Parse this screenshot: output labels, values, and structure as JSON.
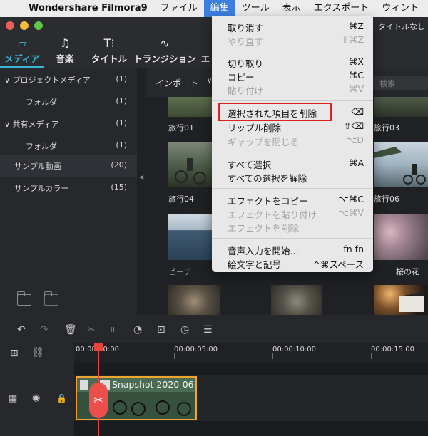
{
  "menubar": {
    "app_name": "Wondershare Filmora9",
    "items": [
      "ファイル",
      "編集",
      "ツール",
      "表示",
      "エクスポート",
      "ウィント"
    ]
  },
  "window": {
    "title_right": "タイトルなし"
  },
  "tabs": [
    {
      "label": "メディア",
      "icon": "folder-icon"
    },
    {
      "label": "音楽",
      "icon": "music-note-icon"
    },
    {
      "label": "タイトル",
      "icon": "title-text-icon"
    },
    {
      "label": "トランジション",
      "icon": "transition-icon"
    },
    {
      "label": "エ",
      "icon": "effects-icon"
    }
  ],
  "sidebar": {
    "items": [
      {
        "label": "∨ プロジェクトメディア",
        "count": "(1)"
      },
      {
        "label": "フォルダ",
        "count": "(1)"
      },
      {
        "label": "∨ 共有メディア",
        "count": "(1)"
      },
      {
        "label": "フォルダ",
        "count": "(1)"
      },
      {
        "label": "サンプル動画",
        "count": "(20)"
      },
      {
        "label": "サンプルカラー",
        "count": "(15)"
      }
    ]
  },
  "media": {
    "import_label": "インポート",
    "search_placeholder": "検索",
    "captions": [
      "旅行01",
      "旅行03",
      "旅行04",
      "旅行06",
      "ビーチ",
      "桜の花"
    ]
  },
  "edit_menu": {
    "items": [
      {
        "label": "取り消す",
        "shortcut": "⌘Z",
        "enabled": true
      },
      {
        "label": "やり直す",
        "shortcut": "⇧⌘Z",
        "enabled": false
      },
      {
        "label": "切り取り",
        "shortcut": "⌘X",
        "enabled": true
      },
      {
        "label": "コピー",
        "shortcut": "⌘C",
        "enabled": true
      },
      {
        "label": "貼り付け",
        "shortcut": "⌘V",
        "enabled": false
      },
      {
        "label": "選択された項目を削除",
        "shortcut": "⌫",
        "enabled": true,
        "highlighted": true
      },
      {
        "label": "リップル削除",
        "shortcut": "⇧⌫",
        "enabled": true
      },
      {
        "label": "ギャップを閉じる",
        "shortcut": "⌥D",
        "enabled": false
      },
      {
        "label": "すべて選択",
        "shortcut": "⌘A",
        "enabled": true
      },
      {
        "label": "すべての選択を解除",
        "shortcut": "",
        "enabled": true
      },
      {
        "label": "エフェクトをコピー",
        "shortcut": "⌥⌘C",
        "enabled": true
      },
      {
        "label": "エフェクトを貼り付け",
        "shortcut": "⌥⌘V",
        "enabled": false
      },
      {
        "label": "エフェクトを削除",
        "shortcut": "",
        "enabled": false
      },
      {
        "label": "音声入力を開始...",
        "shortcut": "fn fn",
        "enabled": true
      },
      {
        "label": "絵文字と記号",
        "shortcut": "^⌘スペース",
        "enabled": true
      }
    ]
  },
  "timeline": {
    "ruler": [
      "00:00:00:00",
      "00:00:05:00",
      "00:00:10:00",
      "00:00:15:00"
    ],
    "clip_label": "Snapshot 2020-06"
  },
  "colors": {
    "accent": "#39b6d8",
    "menu_highlight": "#3c7fe1",
    "highlight_box": "#e0201c",
    "playhead": "#e8433f",
    "clip_border": "#f0a531"
  }
}
